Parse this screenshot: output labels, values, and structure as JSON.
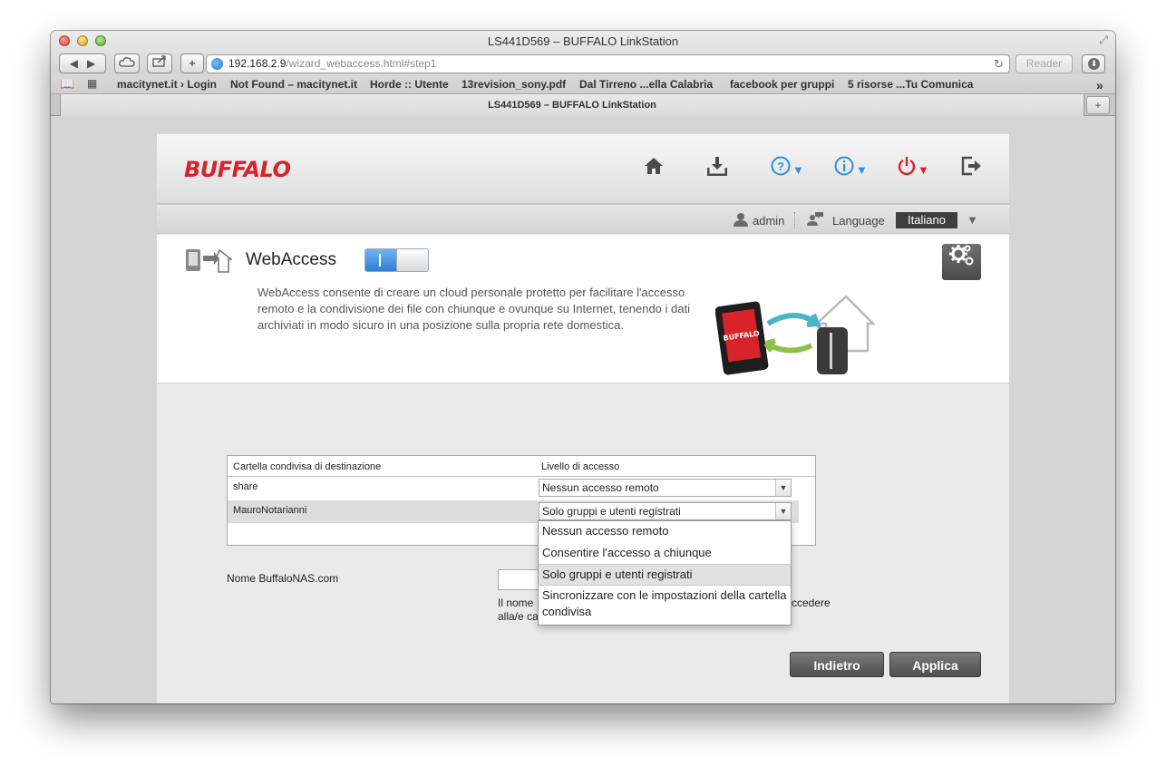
{
  "window": {
    "title": "LS441D569 – BUFFALO LinkStation"
  },
  "toolbar": {
    "back_icon": "◀",
    "forward_icon": "▶",
    "add_icon": "+",
    "url_host": "192.168.2.9",
    "url_path": "/wizard_webaccess.html#step1",
    "reader_label": "Reader"
  },
  "bookmarks": {
    "items": [
      "macitynet.it › Login",
      "Not Found – macitynet.it",
      "Horde :: Utente",
      "13revision_sony.pdf",
      "Dal Tirreno ...ella Calabria",
      "facebook per gruppi",
      "5 risorse ...Tu Comunica"
    ],
    "overflow_icon": "»"
  },
  "tab": {
    "title": "LS441D569 – BUFFALO LinkStation"
  },
  "header": {
    "logo": "BUFFALO",
    "colors": {
      "brand": "#d8232a",
      "help_icons": "#2b8fe0"
    }
  },
  "userbar": {
    "username": "admin",
    "language_label": "Language",
    "language_value": "Italiano"
  },
  "intro": {
    "title": "WebAccess",
    "description": "WebAccess consente di creare un cloud personale protetto per facilitare l'accesso remoto e la condivisione dei file con chiunque e ovunque su Internet, tenendo i dati archiviati in modo sicuro in una posizione sulla propria rete domestica.",
    "toggle_state": "on",
    "illustration_logo": "BUFFALO"
  },
  "share_table": {
    "col_folder": "Cartella condivisa di destinazione",
    "col_access": "Livello di accesso",
    "rows": [
      {
        "folder": "share",
        "access": "Nessun accesso remoto"
      },
      {
        "folder": "MauroNotarianni",
        "access": "Solo gruppi e utenti registrati"
      }
    ]
  },
  "dropdown": {
    "options": [
      "Nessun accesso remoto",
      "Consentire l'accesso a chiunque",
      "Solo gruppi e utenti registrati",
      "Sincronizzare con le impostazioni della cartella condivisa"
    ],
    "selected": "Solo gruppi e utenti registrati"
  },
  "nas": {
    "label": "Nome BuffaloNAS.com",
    "help_line1": "Il nome",
    "help_line2": "alla/e ca",
    "help_tail": "ccedere"
  },
  "buttons": {
    "back": "Indietro",
    "apply": "Applica"
  }
}
